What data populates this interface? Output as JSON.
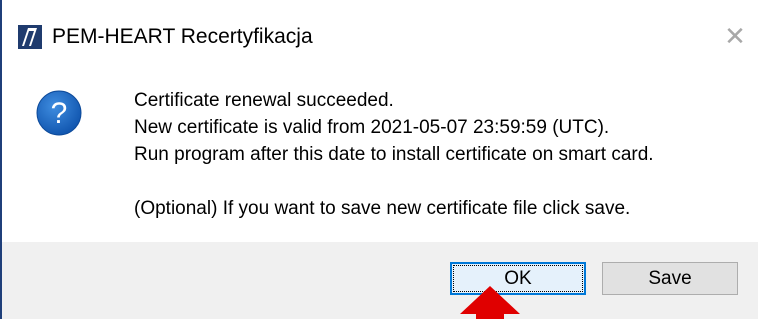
{
  "window": {
    "title": "PEM-HEART Recertyfikacja",
    "close_symbol": "✕"
  },
  "message": {
    "line1": "Certificate renewal succeeded.",
    "line2": "New certificate is valid from 2021-05-07 23:59:59 (UTC).",
    "line3": "Run program after this date to install certificate on smart card.",
    "line4": "(Optional) If you want to save new certificate file click save."
  },
  "buttons": {
    "ok_label": "OK",
    "save_label": "Save"
  },
  "icons": {
    "app": "app-logo-icon",
    "question": "question-icon",
    "close": "close-icon",
    "annotation": "red-arrow-icon"
  },
  "colors": {
    "question_icon": "#1b6ac9",
    "focus_border": "#0078d7",
    "annotation": "#e00000"
  }
}
